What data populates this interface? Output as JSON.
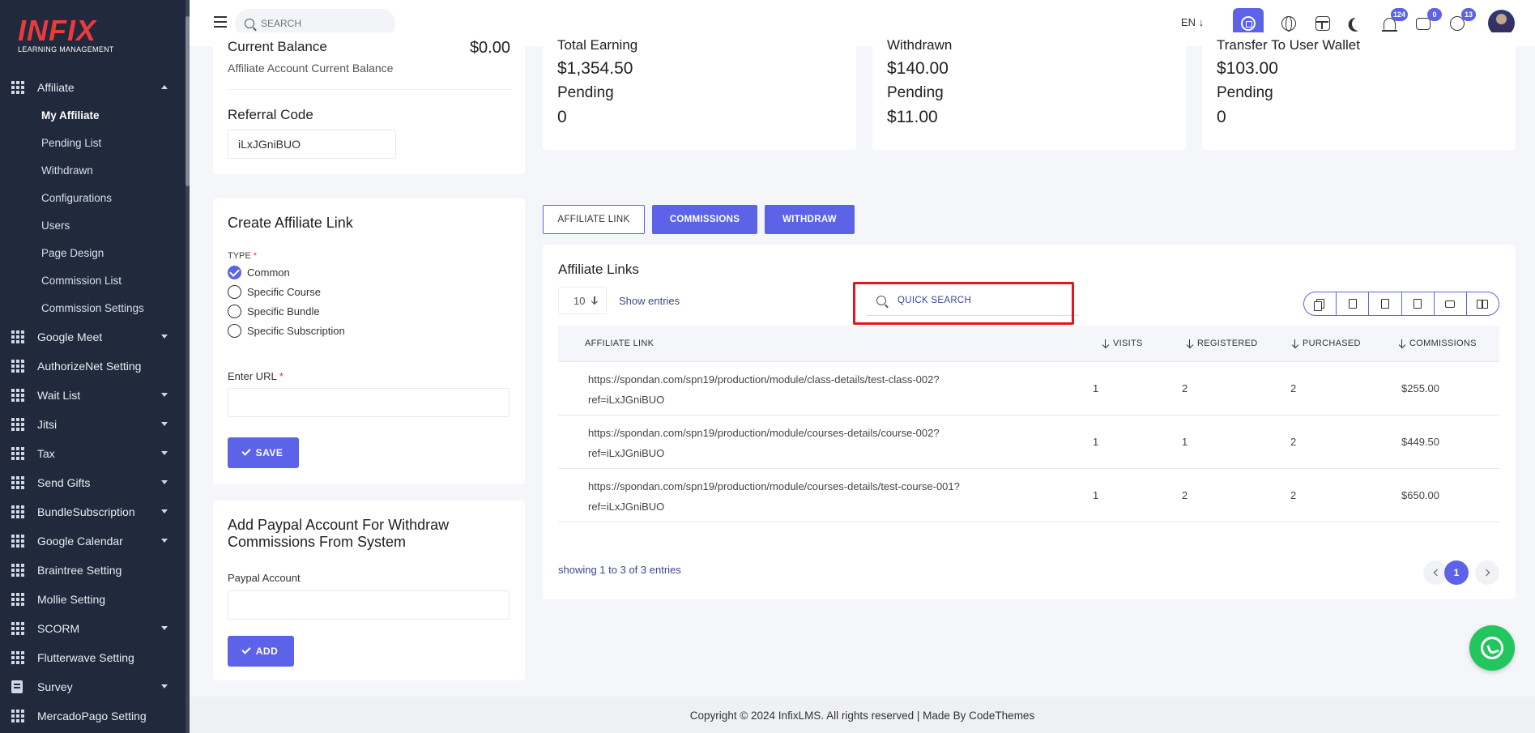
{
  "brand": {
    "name": "INFIX",
    "tagline": "LEARNING MANAGEMENT"
  },
  "header": {
    "search_placeholder": "SEARCH",
    "language": "EN ↓",
    "badges": {
      "notifications": "124",
      "messages": "0",
      "whatsapp": "13"
    }
  },
  "sidebar": {
    "affiliate_label": "Affiliate",
    "affiliate_subitems": [
      "My Affiliate",
      "Pending List",
      "Withdrawn",
      "Configurations",
      "Users",
      "Page Design",
      "Commission List",
      "Commission Settings"
    ],
    "items": [
      {
        "label": "Google Meet",
        "caret": true
      },
      {
        "label": "AuthorizeNet Setting",
        "caret": false
      },
      {
        "label": "Wait List",
        "caret": true
      },
      {
        "label": "Jitsi",
        "caret": true
      },
      {
        "label": "Tax",
        "caret": true
      },
      {
        "label": "Send Gifts",
        "caret": true
      },
      {
        "label": "BundleSubscription",
        "caret": true
      },
      {
        "label": "Google Calendar",
        "caret": true
      },
      {
        "label": "Braintree Setting",
        "caret": false
      },
      {
        "label": "Mollie Setting",
        "caret": false
      },
      {
        "label": "SCORM",
        "caret": true
      },
      {
        "label": "Flutterwave Setting",
        "caret": false
      },
      {
        "label": "Survey",
        "caret": true
      },
      {
        "label": "MercadoPago Setting",
        "caret": false
      }
    ]
  },
  "balance": {
    "title": "Current Balance",
    "value": "$0.00",
    "subtitle": "Affiliate Account Current Balance",
    "referral_label": "Referral Code",
    "referral_code": "iLxJGniBUO"
  },
  "stats": [
    {
      "title": "Total Earning",
      "value": "$1,354.50",
      "pending_label": "Pending",
      "pending_value": "0"
    },
    {
      "title": "Withdrawn",
      "value": "$140.00",
      "pending_label": "Pending",
      "pending_value": "$11.00"
    },
    {
      "title": "Transfer To User Wallet",
      "value": "$103.00",
      "pending_label": "Pending",
      "pending_value": "0"
    }
  ],
  "create_link": {
    "title": "Create Affiliate Link",
    "type_label": "TYPE",
    "required_mark": "*",
    "options": [
      "Common",
      "Specific Course",
      "Specific Bundle",
      "Specific Subscription"
    ],
    "selected": "Common",
    "url_label": "Enter URL",
    "save_label": "SAVE"
  },
  "paypal": {
    "title": "Add Paypal Account For Withdraw Commissions From System",
    "label": "Paypal Account",
    "add_label": "ADD"
  },
  "tabs": [
    "AFFILIATE LINK",
    "COMMISSIONS",
    "WITHDRAW"
  ],
  "table": {
    "title": "Affiliate Links",
    "entries_value": "10",
    "show_entries": "Show entries",
    "search_placeholder": "QUICK SEARCH",
    "columns": [
      "AFFILIATE LINK",
      "VISITS",
      "REGISTERED",
      "PURCHASED",
      "COMMISSIONS"
    ],
    "rows": [
      {
        "link1": "https://spondan.com/spn19/production/module/class-details/test-class-002?",
        "link2": "ref=iLxJGniBUO",
        "visits": "1",
        "registered": "2",
        "purchased": "2",
        "commissions": "$255.00"
      },
      {
        "link1": "https://spondan.com/spn19/production/module/courses-details/course-002?",
        "link2": "ref=iLxJGniBUO",
        "visits": "1",
        "registered": "1",
        "purchased": "2",
        "commissions": "$449.50"
      },
      {
        "link1": "https://spondan.com/spn19/production/module/courses-details/test-course-001?",
        "link2": "ref=iLxJGniBUO",
        "visits": "1",
        "registered": "2",
        "purchased": "2",
        "commissions": "$650.00"
      }
    ],
    "showing": "showing 1 to 3 of 3 entries",
    "current_page": "1"
  },
  "footer": "Copyright © 2024 InfixLMS. All rights reserved | Made By CodeThemes",
  "colors": {
    "accent": "#5c63e8",
    "sidebar": "#202a3c",
    "highlight": "#e8141b",
    "whatsapp": "#22c55e"
  }
}
